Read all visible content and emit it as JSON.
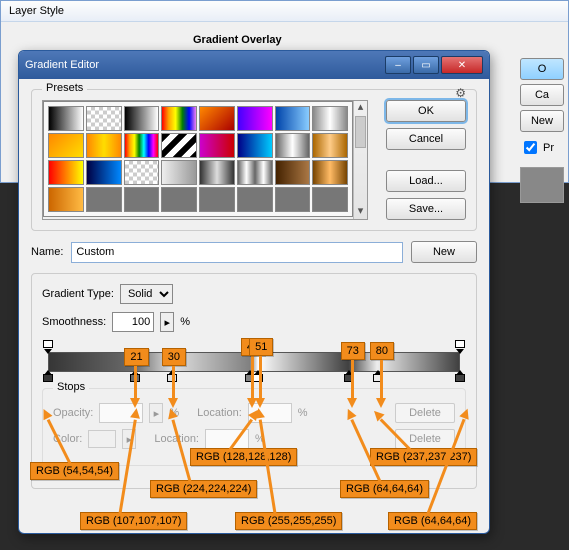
{
  "layer_style": {
    "title": "Layer Style",
    "section": "Gradient Overlay",
    "buttons": {
      "ok_trunc": "O",
      "cancel": "Ca",
      "new": "New",
      "preview": "Pr"
    }
  },
  "gradient_editor": {
    "title": "Gradient Editor",
    "presets_label": "Presets",
    "buttons": {
      "ok": "OK",
      "cancel": "Cancel",
      "load": "Load...",
      "save": "Save...",
      "new": "New",
      "delete": "Delete"
    },
    "name_label": "Name:",
    "name_value": "Custom",
    "gradient_type_label": "Gradient Type:",
    "gradient_type_value": "Solid",
    "smoothness_label": "Smoothness:",
    "smoothness_value": "100",
    "smoothness_unit": "%",
    "stops_label": "Stops",
    "opacity_label": "Opacity:",
    "location_label": "Location:",
    "color_label": "Color:",
    "percent": "%"
  },
  "preset_gradients": [
    "linear-gradient(90deg,#000,#fff)",
    "repeating-conic-gradient(#ccc 0 25%,#fff 0 50%) 0/8px 8px",
    "linear-gradient(90deg,#000,#fff)",
    "linear-gradient(90deg,red,orange,yellow,green,blue,violet)",
    "linear-gradient(135deg,#f80,#a00)",
    "linear-gradient(90deg,#40f,#f0f)",
    "linear-gradient(90deg,#0044aa,#88ccff)",
    "linear-gradient(90deg,#888,#fff,#888)",
    "linear-gradient(135deg,#f80,#fd0)",
    "linear-gradient(90deg,#f80,#fd0,#f80)",
    "linear-gradient(90deg,red,orange,yellow,green,cyan,blue,magenta,red)",
    "repeating-linear-gradient(135deg,#000 0 6px,#fff 6px 12px)",
    "linear-gradient(90deg,#c0c,#c00)",
    "linear-gradient(90deg,#008,#0cf)",
    "linear-gradient(90deg,#666,#fff,#666)",
    "linear-gradient(90deg,#a60,#fc8,#a60)",
    "linear-gradient(90deg,#f00,#ff0)",
    "linear-gradient(90deg,#004,#08f)",
    "repeating-conic-gradient(#ccc 0 25%,#fff 0 50%) 0/8px 8px",
    "linear-gradient(90deg,#eee,#999)",
    "linear-gradient(90deg,#333,#ddd,#333)",
    "linear-gradient(90deg,#666,#fff,#666,#fff,#666)",
    "linear-gradient(90deg,#420,#a74)",
    "linear-gradient(90deg,#740,#fb6,#740)",
    "linear-gradient(90deg,#c60,#fb4)",
    "#777",
    "#777",
    "#777",
    "#777",
    "#777",
    "#777",
    "#777"
  ],
  "opacity_stops": [
    0,
    100
  ],
  "color_stops": [
    {
      "loc": 0,
      "rgb": "54,54,54"
    },
    {
      "loc": 21,
      "rgb": "107,107,107"
    },
    {
      "loc": 30,
      "rgb": "224,224,224"
    },
    {
      "loc": 49,
      "rgb": "128,128,128"
    },
    {
      "loc": 51,
      "rgb": "255,255,255"
    },
    {
      "loc": 73,
      "rgb": "64,64,64"
    },
    {
      "loc": 80,
      "rgb": "237,237,237"
    },
    {
      "loc": 100,
      "rgb": "64,64,64"
    }
  ],
  "annotations": {
    "loc_tags": [
      "21",
      "30",
      "49",
      "51",
      "73",
      "80"
    ],
    "rgb_tags": [
      "RGB (54,54,54)",
      "RGB (128,128,128)",
      "RGB (237,237,237)",
      "RGB (224,224,224)",
      "RGB (64,64,64)",
      "RGB (107,107,107)",
      "RGB (255,255,255)",
      "RGB (64,64,64)"
    ]
  }
}
